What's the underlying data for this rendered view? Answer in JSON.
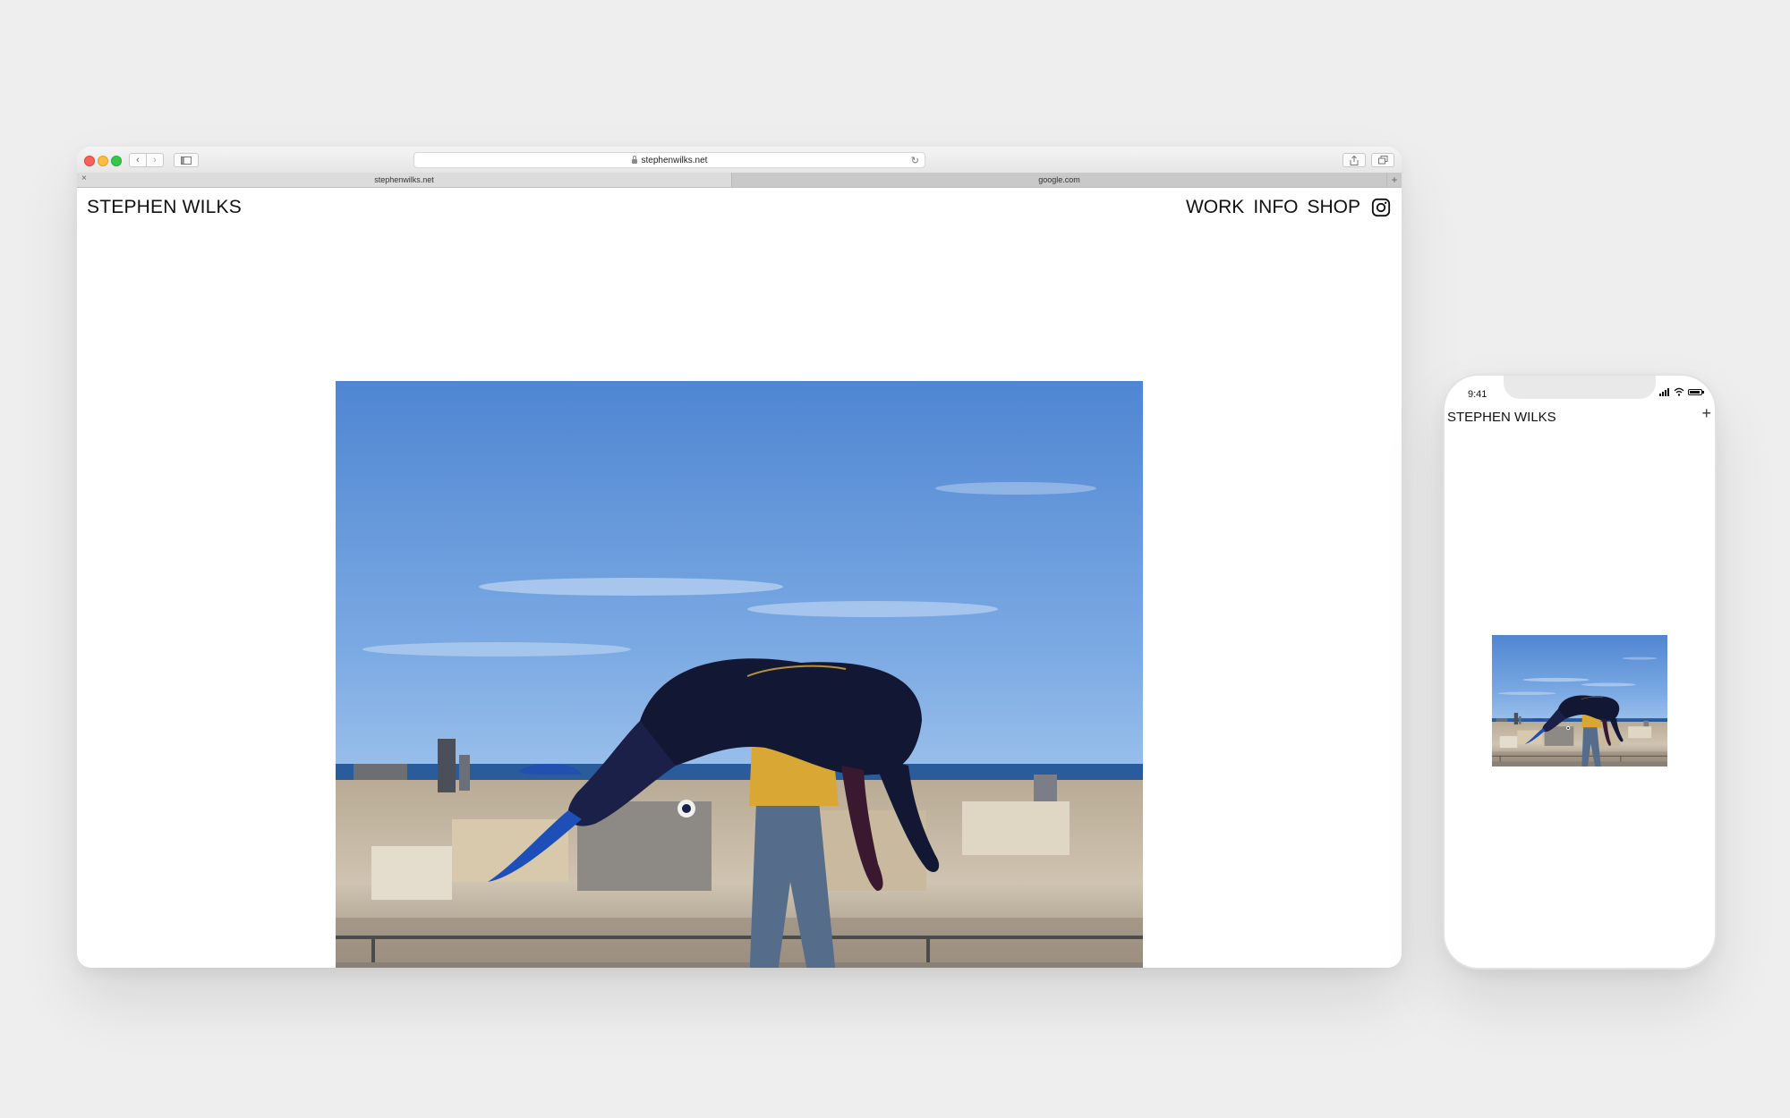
{
  "browser": {
    "url": "stephenwilks.net",
    "tabs": [
      {
        "label": "stephenwilks.net",
        "active": true
      },
      {
        "label": "google.com",
        "active": false
      }
    ]
  },
  "site": {
    "title": "STEPHEN WILKS",
    "nav": [
      {
        "label": "WORK"
      },
      {
        "label": "INFO"
      },
      {
        "label": "SHOP"
      }
    ]
  },
  "phone": {
    "status_time": "9:41",
    "title": "STEPHEN WILKS",
    "menu_symbol": "+"
  },
  "icons": {
    "close_tab": "×",
    "new_tab": "+",
    "back": "‹",
    "forward": "›",
    "reload": "↻"
  }
}
